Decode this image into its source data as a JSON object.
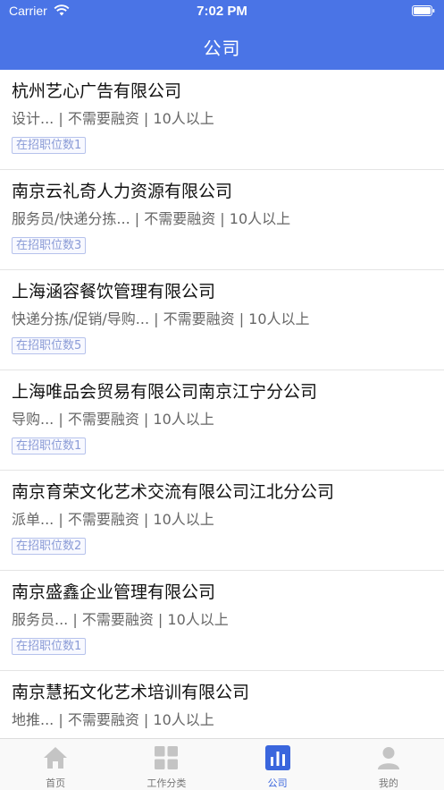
{
  "status_bar": {
    "carrier": "Carrier",
    "time": "7:02 PM"
  },
  "header": {
    "title": "公司"
  },
  "companies": [
    {
      "name": "杭州艺心广告有限公司",
      "meta": "设计... | 不需要融资 | 10人以上",
      "badge": "在招职位数1"
    },
    {
      "name": "南京云礼奇人力资源有限公司",
      "meta": "服务员/快递分拣... | 不需要融资 | 10人以上",
      "badge": "在招职位数3"
    },
    {
      "name": "上海涵容餐饮管理有限公司",
      "meta": "快递分拣/促销/导购... | 不需要融资 | 10人以上",
      "badge": "在招职位数5"
    },
    {
      "name": "上海唯品会贸易有限公司南京江宁分公司",
      "meta": "导购... | 不需要融资 | 10人以上",
      "badge": "在招职位数1"
    },
    {
      "name": "南京育荣文化艺术交流有限公司江北分公司",
      "meta": "派单... | 不需要融资 | 10人以上",
      "badge": "在招职位数2"
    },
    {
      "name": "南京盛鑫企业管理有限公司",
      "meta": "服务员... | 不需要融资 | 10人以上",
      "badge": "在招职位数1"
    },
    {
      "name": "南京慧拓文化艺术培训有限公司",
      "meta": "地推... | 不需要融资 | 10人以上",
      "badge": ""
    }
  ],
  "tabs": [
    {
      "label": "首页",
      "icon": "home-icon"
    },
    {
      "label": "工作分类",
      "icon": "grid-icon"
    },
    {
      "label": "公司",
      "icon": "bar-chart-icon"
    },
    {
      "label": "我的",
      "icon": "user-icon"
    }
  ],
  "active_tab": "公司",
  "colors": {
    "brand": "#4a74e6",
    "tab_active": "#3a66dd",
    "tab_inactive": "#c4c4c4",
    "badge_border": "#b6c2ec"
  }
}
